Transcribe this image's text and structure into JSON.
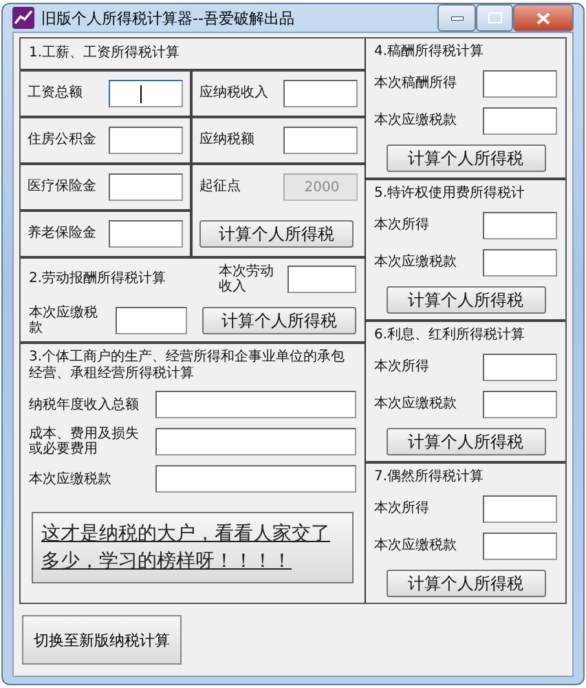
{
  "window": {
    "title": "旧版个人所得税计算器--吾爱破解出品"
  },
  "wage": {
    "title": "1.工薪、工资所得税计算",
    "fields": [
      {
        "label": "工资总额",
        "disabled": false,
        "focused": true
      },
      {
        "label": "应纳税收入",
        "disabled": false,
        "focused": false
      },
      {
        "label": "住房公积金",
        "disabled": false,
        "focused": false
      },
      {
        "label": "应纳税额",
        "disabled": false,
        "focused": false
      },
      {
        "label": "医疗保险金",
        "disabled": false,
        "focused": false
      },
      {
        "label": "起征点",
        "value": "2000",
        "disabled": true,
        "focused": false
      },
      {
        "label": "养老保险金",
        "disabled": false,
        "focused": false
      }
    ],
    "button": "计算个人所得税"
  },
  "labor": {
    "title": "2.劳动报酬所得税计算",
    "income_label": "本次劳动收入",
    "tax_label": "本次应缴税款",
    "button": "计算个人所得税"
  },
  "business": {
    "title": "3.个体工商户的生产、经营所得和企事业单位的承包经营、承租经营所得税计算",
    "fields": [
      {
        "label": "纳税年度收入总额"
      },
      {
        "label": "成本、费用及损失或必要费用"
      },
      {
        "label": "本次应缴税款"
      }
    ],
    "banner": "这才是纳税的大户，看看人家交了多少，学习的榜样呀！！！！"
  },
  "right_sections": [
    {
      "title": "4.稿酬所得税计算",
      "fields": [
        {
          "label": "本次稿酬所得"
        },
        {
          "label": "本次应缴税款"
        }
      ],
      "button": "计算个人所得税"
    },
    {
      "title": "5.特许权使用费所得税计",
      "fields": [
        {
          "label": "本次所得"
        },
        {
          "label": "本次应缴税款"
        }
      ],
      "button": "计算个人所得税"
    },
    {
      "title": "6.利息、红利所得税计算",
      "fields": [
        {
          "label": "本次所得"
        },
        {
          "label": "本次应缴税款"
        }
      ],
      "button": "计算个人所得税"
    },
    {
      "title": "7.偶然所得税计算",
      "fields": [
        {
          "label": "本次所得"
        },
        {
          "label": "本次应缴税款"
        }
      ],
      "button": "计算个人所得税"
    }
  ],
  "switch_button": "切换至新版纳税计算"
}
